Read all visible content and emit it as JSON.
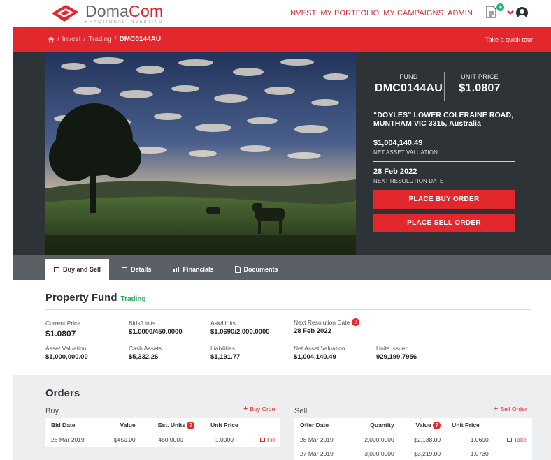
{
  "brand": {
    "name_part1": "Doma",
    "name_part2": "Com",
    "tagline": "FRACTIONAL INVESTING",
    "accent": "#e2272d"
  },
  "nav": {
    "items": [
      "INVEST",
      "MY PORTFOLIO",
      "MY CAMPAIGNS",
      "ADMIN"
    ]
  },
  "header_icons": {
    "doc_badge": "+"
  },
  "breadcrumb": {
    "home_icon": "home-icon",
    "sep": "/",
    "items": [
      "Invest",
      "Trading"
    ],
    "current": "DMC0144AU",
    "tour": "Take a quick tour"
  },
  "fund": {
    "fund_label": "FUND",
    "fund_code": "DMC0144AU",
    "price_label": "UNIT PRICE",
    "unit_price": "$1.0807",
    "address": "“DOYLES” LOWER COLERAINE ROAD, MUNTHAM VIC 3315, Australia",
    "nav_value": "$1,004,140.49",
    "nav_label": "NET ASSET VALUATION",
    "resolution_date": "28 Feb 2022",
    "resolution_label": "NEXT RESOLUTION DATE",
    "buy_button": "PLACE BUY ORDER",
    "sell_button": "PLACE SELL ORDER"
  },
  "tabs": [
    {
      "label": "Buy and Sell",
      "active": true
    },
    {
      "label": "Details",
      "active": false
    },
    {
      "label": "Financials",
      "active": false
    },
    {
      "label": "Documents",
      "active": false
    }
  ],
  "property": {
    "title": "Property Fund",
    "status": "Trading",
    "current_price_label": "Current Price",
    "current_price": "$1.0807",
    "bids_label": "Bids/Units",
    "bids": "$1.0000/450.0000",
    "ask_label": "Ask/Units",
    "ask": "$1.0690/2,000.0000",
    "next_res_label": "Next Resolution Date",
    "next_res": "28 Feb 2022",
    "asset_val_label": "Asset Valuation",
    "asset_val": "$1,000,000.00",
    "cash_label": "Cash Assets",
    "cash": "$5,332.26",
    "liab_label": "Liabilities",
    "liab": "$1,191.77",
    "nav_label": "Net Asset Valuation",
    "nav": "$1,004,140.49",
    "units_label": "Units issued",
    "units": "929,199.7956"
  },
  "orders": {
    "title": "Orders",
    "buy": {
      "label": "Buy",
      "action": "Buy Order",
      "headers": [
        "Bid Date",
        "Value",
        "Est. Units",
        "Unit Price"
      ],
      "rows": [
        {
          "date": "26 Mar 2019",
          "value": "$450.00",
          "units": "450.0000",
          "price": "1.0000",
          "action": "Fill"
        }
      ]
    },
    "sell": {
      "label": "Sell",
      "action": "Sell Order",
      "headers": [
        "Offer Date",
        "Quantity",
        "Value",
        "Unit Price"
      ],
      "rows": [
        {
          "date": "28 Mar 2019",
          "qty": "2,000.0000",
          "value": "$2,138.00",
          "price": "1.0690",
          "action": "Take"
        },
        {
          "date": "27 Mar 2019",
          "qty": "3,000.0000",
          "value": "$3,219.00",
          "price": "1.0730",
          "action": ""
        }
      ]
    }
  }
}
